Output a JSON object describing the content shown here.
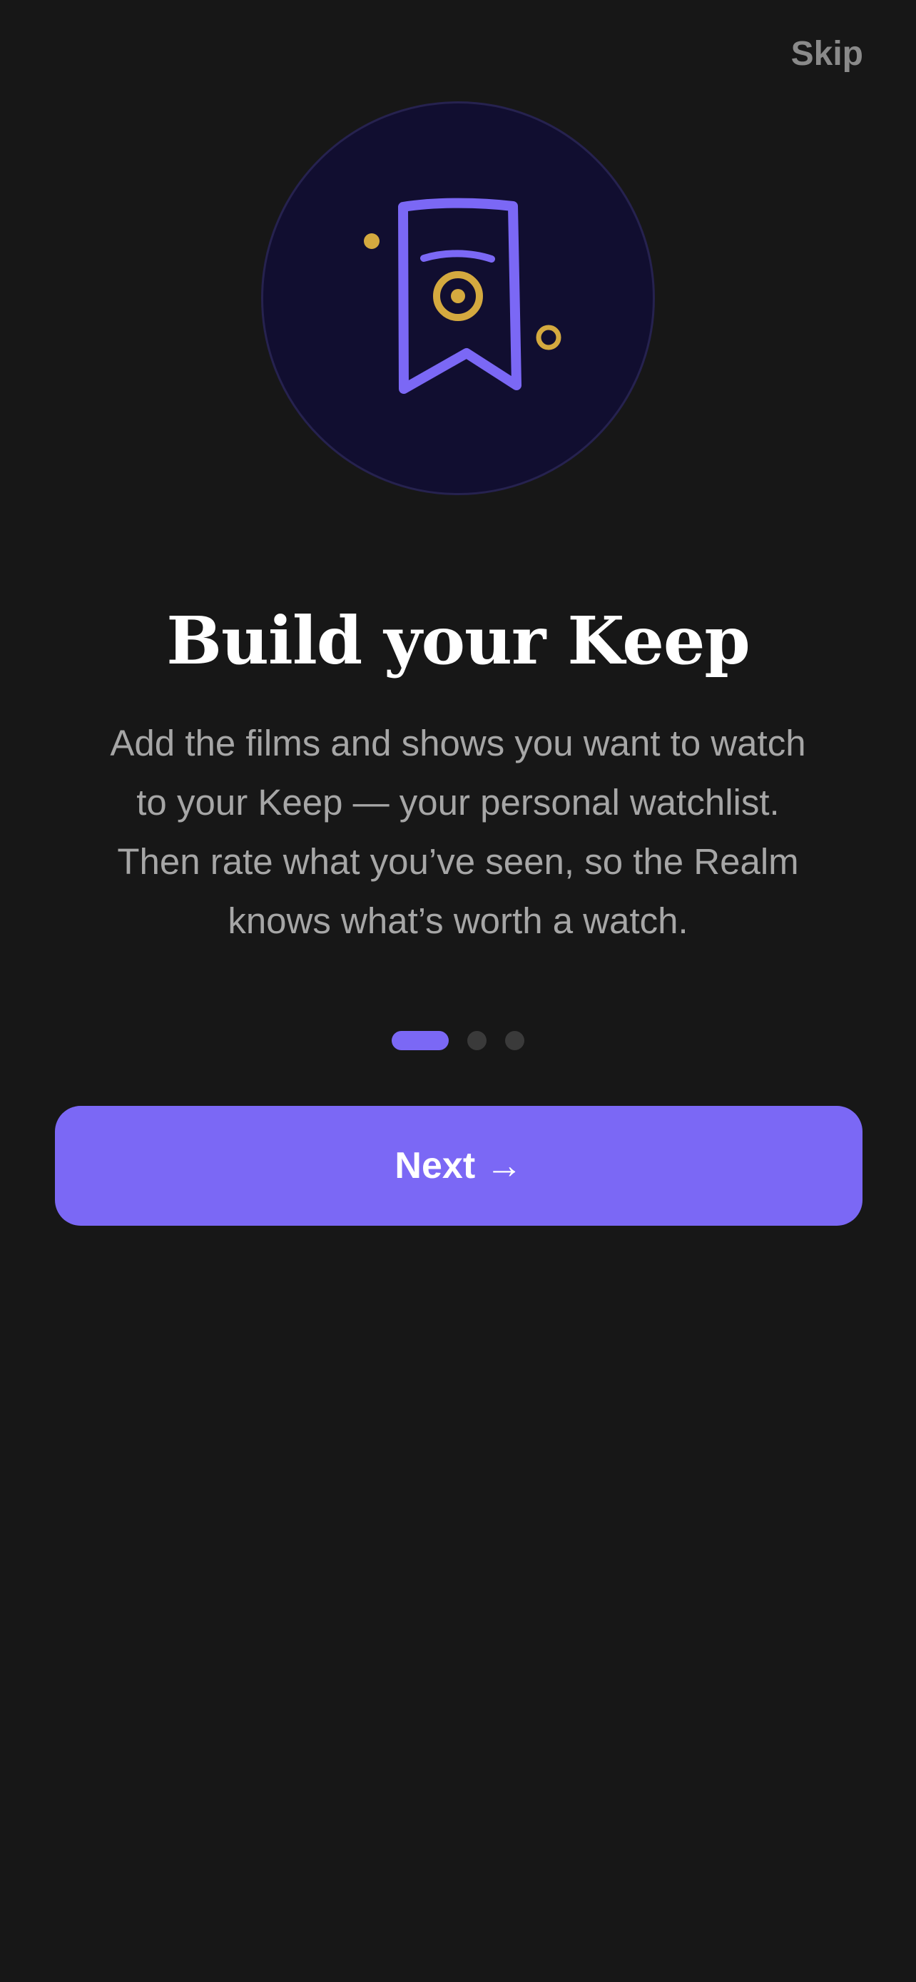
{
  "header": {
    "skip_label": "Skip"
  },
  "hero": {
    "icon": "bookmark-icon",
    "accent_color": "#7b68f5",
    "gold_color": "#d4a93f"
  },
  "content": {
    "title": "Build your Keep",
    "description": "Add the films and shows you want to watch to your Keep — your personal watchlist. Then rate what you’ve seen, so the Realm knows what’s worth a watch."
  },
  "pagination": {
    "total": 3,
    "current": 1
  },
  "actions": {
    "next_label": "Next →"
  },
  "colors": {
    "background": "#171717",
    "primary": "#7b68f5",
    "muted_text": "#a6a6a6"
  }
}
